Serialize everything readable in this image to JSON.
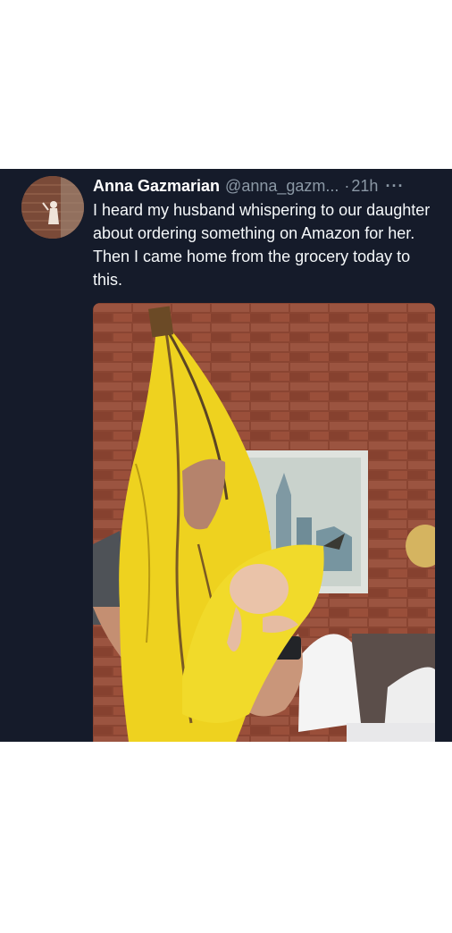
{
  "tweet": {
    "author_name": "Anna Gazmarian",
    "handle": "@anna_gazm...",
    "separator": "·",
    "time": "21h",
    "more_glyph": "···",
    "text": "I heard my husband whispering to our daughter about ordering something on Amazon for her. Then I came home from the grocery today to this."
  },
  "colors": {
    "tweet_background": "#151b2a",
    "secondary_text": "#8b98a5",
    "brick": "#8e4a35",
    "banana_yellow": "#f0d41e"
  },
  "icons": {
    "more": "more-horizontal-icon"
  }
}
